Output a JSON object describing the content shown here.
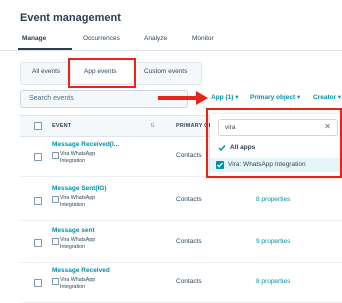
{
  "header": {
    "title": "Event management"
  },
  "main_tabs": [
    {
      "label": "Manage",
      "active": true
    },
    {
      "label": "Occurrences",
      "active": false
    },
    {
      "label": "Analyze",
      "active": false
    },
    {
      "label": "Monitor",
      "active": false
    }
  ],
  "sub_tabs": [
    {
      "label": "All events",
      "active": false
    },
    {
      "label": "App events",
      "active": true
    },
    {
      "label": "Custom events",
      "active": false
    }
  ],
  "toolbar": {
    "search_placeholder": "Search events",
    "filter_app": "App (1) ▾",
    "filter_primary_object": "Primary object ▾",
    "filter_creator": "Creator ▾"
  },
  "table": {
    "columns": [
      "EVENT",
      "PRIMARY OBJECT"
    ],
    "rows": [
      {
        "name": "Message Received(I...",
        "app": "Vira WhatsApp Integration",
        "object": "Contacts",
        "properties": ""
      },
      {
        "name": "Message Sent(IG)",
        "app": "Vira WhatsApp Integration",
        "object": "Contacts",
        "properties": "8 properties"
      },
      {
        "name": "Message sent",
        "app": "Vira WhatsApp Integration",
        "object": "Contacts",
        "properties": "9 properties"
      },
      {
        "name": "Message Received",
        "app": "Vira WhatsApp Integration",
        "object": "Contacts",
        "properties": "8 properties"
      }
    ]
  },
  "app_filter_dropdown": {
    "search_value": "vira",
    "all_label": "All apps",
    "options": [
      {
        "label": "Vira: WhatsApp Integration",
        "checked": true
      }
    ]
  },
  "colors": {
    "accent": "#0091ae",
    "highlight": "#e8231c",
    "checkbox": "#0091ae"
  }
}
